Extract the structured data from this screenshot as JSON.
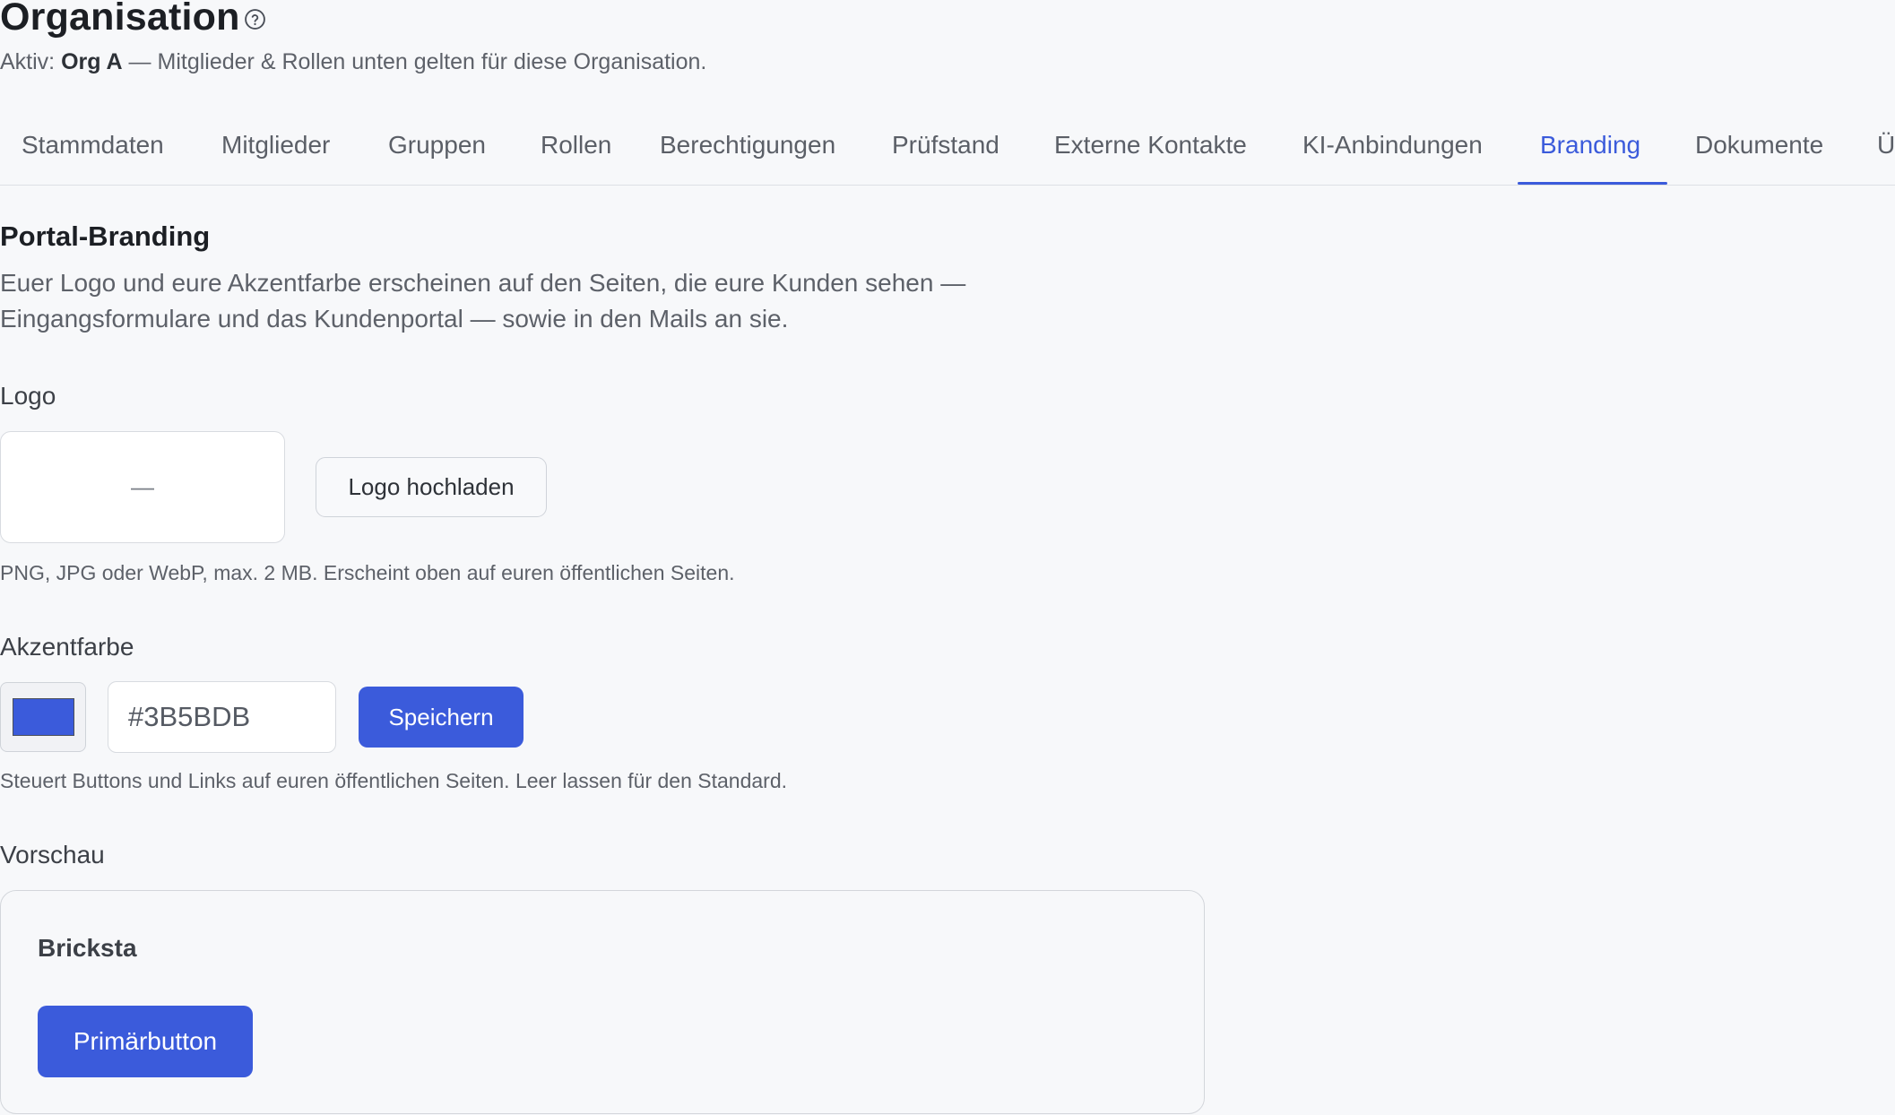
{
  "header": {
    "title": "Organisation",
    "help_icon": "question-circle-icon",
    "subtitle_prefix": "Aktiv: ",
    "active_org": "Org A",
    "subtitle_suffix": " — Mitglieder & Rollen unten gelten für diese Organisation."
  },
  "tabs": [
    {
      "label": "Stammdaten"
    },
    {
      "label": "Mitglieder"
    },
    {
      "label": "Gruppen"
    },
    {
      "label": "Rollen"
    },
    {
      "label": "Berechtigungen"
    },
    {
      "label": "Prüfstand"
    },
    {
      "label": "Externe Kontakte"
    },
    {
      "label": "KI-Anbindungen"
    },
    {
      "label": "Branding",
      "active": true
    },
    {
      "label": "Dokumente"
    },
    {
      "label": "Ü"
    }
  ],
  "section": {
    "heading": "Portal-Branding",
    "description_line1": "Euer Logo und eure Akzentfarbe erscheinen auf den Seiten, die eure Kunden sehen —",
    "description_line2": "Eingangsformulare und das Kundenportal — sowie in den Mails an sie."
  },
  "logo": {
    "label": "Logo",
    "placeholder": "—",
    "upload_button": "Logo hochladen",
    "help": "PNG, JPG oder WebP, max. 2 MB. Erscheint oben auf euren öffentlichen Seiten."
  },
  "accent": {
    "label": "Akzentfarbe",
    "color": "#3B5BDB",
    "hex_value": "#3B5BDB",
    "save_button": "Speichern",
    "help": "Steuert Buttons und Links auf euren öffentlichen Seiten. Leer lassen für den Standard."
  },
  "preview": {
    "label": "Vorschau",
    "brand_name": "Bricksta",
    "primary_button": "Primärbutton"
  },
  "colors": {
    "accent": "#3b5bdb",
    "background": "#f7f8fa",
    "text_dark": "#1c1f24",
    "text_muted": "#5d6169"
  }
}
